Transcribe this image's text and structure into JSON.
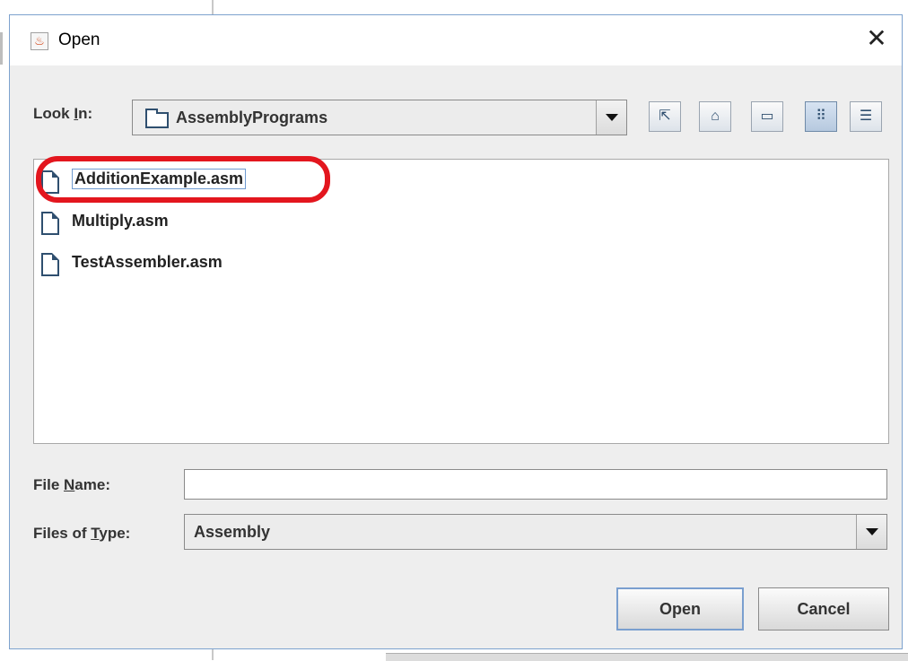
{
  "window": {
    "title": "Open",
    "app_icon": "java-icon",
    "close_glyph": "✕"
  },
  "look_in": {
    "label_prefix": "Look ",
    "label_mnemonic": "I",
    "label_suffix": "n:",
    "value": "AssemblyPrograms",
    "icon": "folder-icon"
  },
  "toolbar": [
    {
      "name": "up-one-level-button",
      "icon": "folder-up-icon",
      "glyph": "⇱",
      "active": false
    },
    {
      "name": "home-button",
      "icon": "home-icon",
      "glyph": "⌂",
      "active": false
    },
    {
      "name": "new-folder-button",
      "icon": "new-folder-icon",
      "glyph": "▭",
      "active": false
    },
    {
      "name": "list-view-button",
      "icon": "list-view-icon",
      "glyph": "⠿",
      "active": true
    },
    {
      "name": "details-view-button",
      "icon": "details-view-icon",
      "glyph": "☰",
      "active": false
    }
  ],
  "files": [
    {
      "name": "AdditionExample.asm",
      "selected": true
    },
    {
      "name": "Multiply.asm",
      "selected": false
    },
    {
      "name": "TestAssembler.asm",
      "selected": false
    }
  ],
  "file_name": {
    "label_prefix": "File ",
    "label_mnemonic": "N",
    "label_suffix": "ame:",
    "value": ""
  },
  "file_type": {
    "label_prefix": "Files of ",
    "label_mnemonic": "T",
    "label_suffix": "ype:",
    "value": "Assembly"
  },
  "buttons": {
    "open_label": "Open",
    "cancel_label": "Cancel"
  },
  "colors": {
    "highlight_ring": "#e3161e",
    "dialog_bg": "#eeeeee",
    "selection_border": "#6f9bd0"
  }
}
